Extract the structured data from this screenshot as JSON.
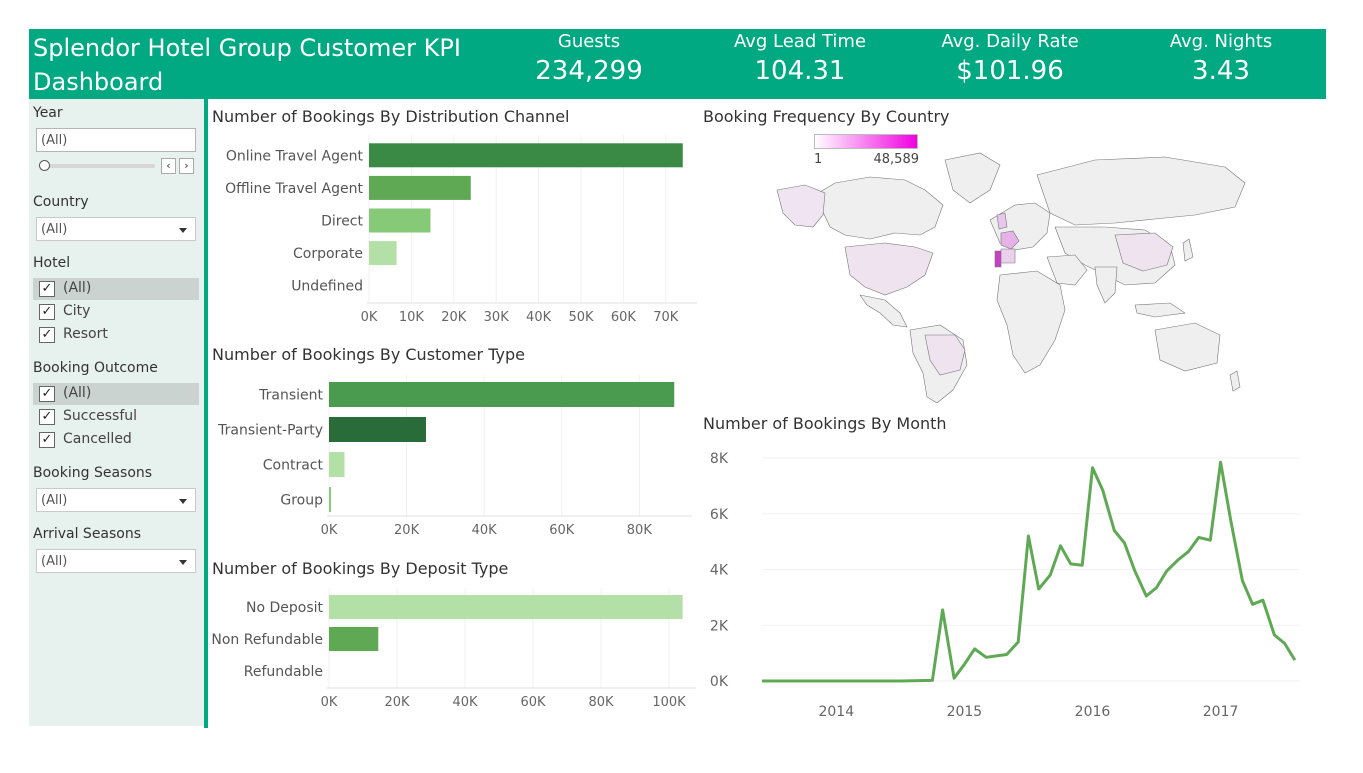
{
  "header": {
    "title": "Splendor Hotel Group Customer KPI Dashboard",
    "kpis": [
      {
        "label": "Guests",
        "value": "234,299"
      },
      {
        "label": "Avg Lead Time",
        "value": "104.31"
      },
      {
        "label": "Avg. Daily Rate",
        "value": "$101.96"
      },
      {
        "label": "Avg. Nights",
        "value": "3.43"
      }
    ]
  },
  "filters": {
    "year": {
      "title": "Year",
      "value": "(All)"
    },
    "country": {
      "title": "Country",
      "value": "(All)"
    },
    "hotel": {
      "title": "Hotel",
      "options": [
        "(All)",
        "City",
        "Resort"
      ]
    },
    "booking_outcome": {
      "title": "Booking Outcome",
      "options": [
        "(All)",
        "Successful",
        "Cancelled"
      ]
    },
    "booking_seasons": {
      "title": "Booking Seasons",
      "value": "(All)"
    },
    "arrival_seasons": {
      "title": "Arrival Seasons",
      "value": "(All)"
    }
  },
  "map": {
    "title": "Booking Frequency By Country",
    "legend_min": "1",
    "legend_max": "48,589",
    "color_low": "#ffffff",
    "color_high": "#f000e0"
  },
  "chart_data": [
    {
      "type": "bar",
      "title": "Number of Bookings By Distribution Channel",
      "categories": [
        "Online Travel Agent",
        "Offline Travel Agent",
        "Direct",
        "Corporate",
        "Undefined"
      ],
      "values": [
        74000,
        24000,
        14500,
        6500,
        0
      ],
      "colors": [
        "#3a8a45",
        "#5fa954",
        "#86c977",
        "#b3e0a6",
        "#b3e0a6"
      ],
      "xticks": [
        "0K",
        "10K",
        "20K",
        "30K",
        "40K",
        "50K",
        "60K",
        "70K"
      ],
      "xlim": [
        0,
        75000
      ]
    },
    {
      "type": "bar",
      "title": "Number of Bookings By Customer Type",
      "categories": [
        "Transient",
        "Transient-Party",
        "Contract",
        "Group"
      ],
      "values": [
        89000,
        25000,
        4000,
        500
      ],
      "colors": [
        "#4a9a50",
        "#2a6b3a",
        "#b3e0a6",
        "#86c977"
      ],
      "xticks": [
        "0K",
        "20K",
        "40K",
        "60K",
        "80K"
      ],
      "xlim": [
        0,
        91000
      ]
    },
    {
      "type": "bar",
      "title": "Number of Bookings By Deposit Type",
      "categories": [
        "No Deposit",
        "Non Refundable",
        "Refundable"
      ],
      "values": [
        104000,
        14500,
        0
      ],
      "colors": [
        "#b3e0a6",
        "#5fa954",
        "#b3e0a6"
      ],
      "xticks": [
        "0K",
        "20K",
        "40K",
        "60K",
        "80K",
        "100K"
      ],
      "xlim": [
        0,
        105000
      ]
    },
    {
      "type": "line",
      "title": "Number of Bookings By Month",
      "color": "#5fa954",
      "yticks": [
        "0K",
        "2K",
        "4K",
        "6K",
        "8K"
      ],
      "ylim": [
        0,
        8000
      ],
      "xticks": [
        "2014",
        "2015",
        "2016",
        "2017"
      ],
      "xlim": [
        2013.42,
        2017.62
      ],
      "x": [
        2013.42,
        2014.0,
        2014.5,
        2014.75,
        2014.83,
        2014.92,
        2015.0,
        2015.08,
        2015.17,
        2015.25,
        2015.33,
        2015.42,
        2015.5,
        2015.58,
        2015.67,
        2015.75,
        2015.83,
        2015.92,
        2016.0,
        2016.08,
        2016.17,
        2016.25,
        2016.33,
        2016.42,
        2016.5,
        2016.58,
        2016.67,
        2016.75,
        2016.83,
        2016.92,
        2017.0,
        2017.08,
        2017.17,
        2017.25,
        2017.33,
        2017.42,
        2017.5,
        2017.58
      ],
      "y": [
        0,
        0,
        0,
        20,
        2550,
        100,
        600,
        1150,
        850,
        900,
        950,
        1400,
        5200,
        3300,
        3800,
        4850,
        4200,
        4150,
        7650,
        6850,
        5400,
        4950,
        3950,
        3050,
        3350,
        3950,
        4350,
        4650,
        5150,
        5050,
        7850,
        5750,
        3600,
        2750,
        2900,
        1650,
        1350,
        750
      ]
    }
  ]
}
